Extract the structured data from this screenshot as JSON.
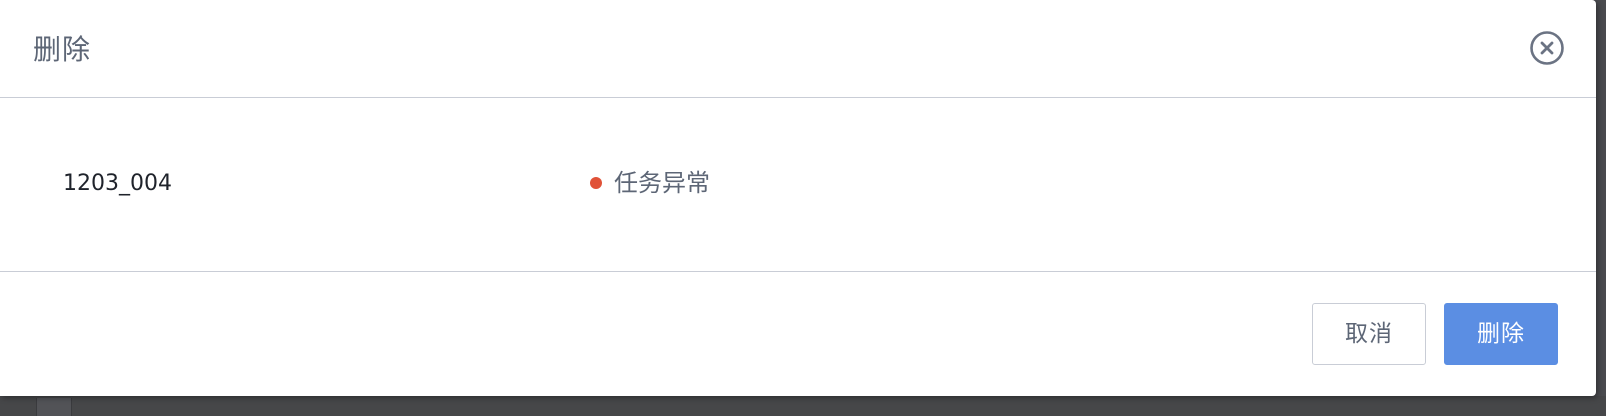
{
  "dialog": {
    "title": "删除",
    "close_icon": "close-circle-icon"
  },
  "body": {
    "item_name": "1203_004",
    "status": {
      "text": "任务异常",
      "color": "#e05238"
    }
  },
  "footer": {
    "cancel_label": "取消",
    "delete_label": "删除"
  },
  "colors": {
    "primary": "#5b8ee3",
    "text_secondary": "#5d6676",
    "border": "#c9cdd6"
  }
}
